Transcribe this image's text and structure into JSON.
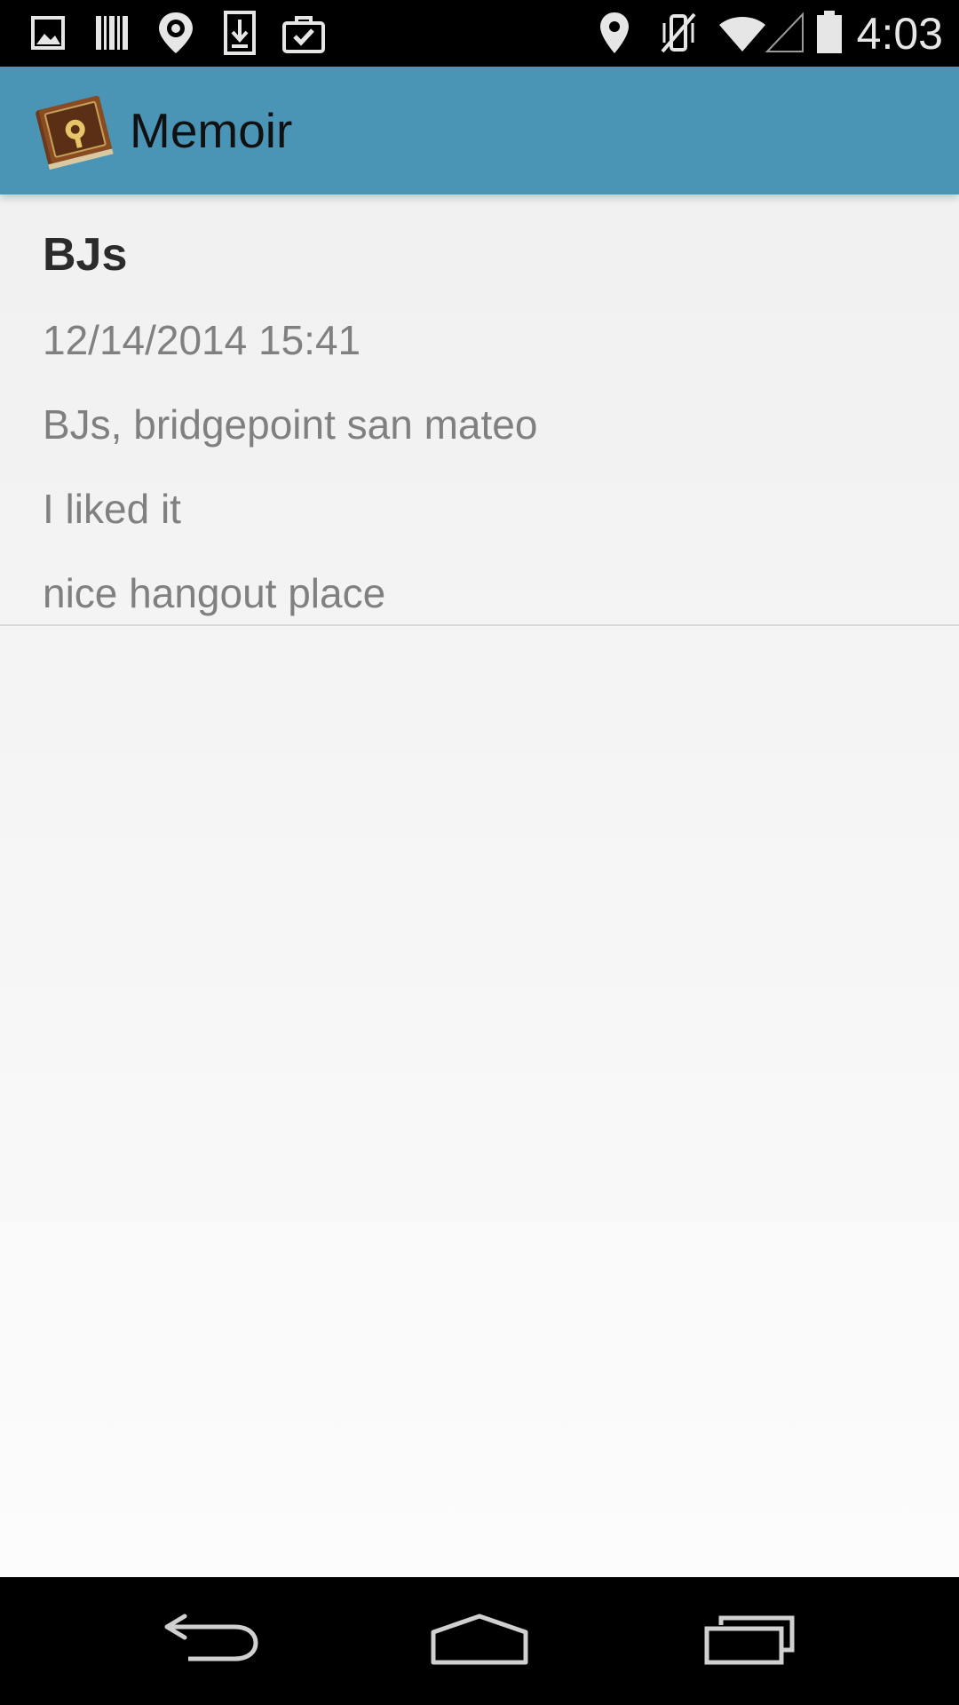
{
  "status_bar": {
    "time": "4:03",
    "left_icons": [
      "image-icon",
      "barcode-icon",
      "location-pin-icon",
      "download-icon",
      "briefcase-check-icon"
    ],
    "right_icons": [
      "location-icon",
      "vibrate-off-icon",
      "wifi-icon",
      "signal-icon",
      "battery-icon"
    ]
  },
  "action_bar": {
    "title": "Memoir",
    "color": "#4a95b6",
    "icon": "diary-book-icon"
  },
  "entry": {
    "title": "BJs",
    "datetime": "12/14/2014 15:41",
    "place": "BJs, bridgepoint san mateo",
    "rating": "I liked it",
    "note": "nice hangout place"
  },
  "nav_bar": {
    "buttons": [
      "back-icon",
      "home-icon",
      "recents-icon"
    ]
  }
}
